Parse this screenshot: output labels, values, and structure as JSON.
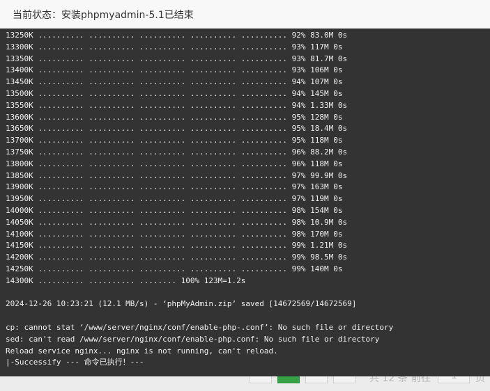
{
  "dialog": {
    "title": "当前状态：安装phpmyadmin-5.1已结束"
  },
  "terminal": {
    "lines": [
      "13250K .......... .......... .......... .......... .......... 92% 83.0M 0s",
      "13300K .......... .......... .......... .......... .......... 93% 117M 0s",
      "13350K .......... .......... .......... .......... .......... 93% 81.7M 0s",
      "13400K .......... .......... .......... .......... .......... 93% 106M 0s",
      "13450K .......... .......... .......... .......... .......... 94% 107M 0s",
      "13500K .......... .......... .......... .......... .......... 94% 145M 0s",
      "13550K .......... .......... .......... .......... .......... 94% 1.33M 0s",
      "13600K .......... .......... .......... .......... .......... 95% 128M 0s",
      "13650K .......... .......... .......... .......... .......... 95% 18.4M 0s",
      "13700K .......... .......... .......... .......... .......... 95% 118M 0s",
      "13750K .......... .......... .......... .......... .......... 96% 88.2M 0s",
      "13800K .......... .......... .......... .......... .......... 96% 118M 0s",
      "13850K .......... .......... .......... .......... .......... 97% 99.9M 0s",
      "13900K .......... .......... .......... .......... .......... 97% 163M 0s",
      "13950K .......... .......... .......... .......... .......... 97% 119M 0s",
      "14000K .......... .......... .......... .......... .......... 98% 154M 0s",
      "14050K .......... .......... .......... .......... .......... 98% 10.9M 0s",
      "14100K .......... .......... .......... .......... .......... 98% 170M 0s",
      "14150K .......... .......... .......... .......... .......... 99% 1.21M 0s",
      "14200K .......... .......... .......... .......... .......... 99% 98.5M 0s",
      "14250K .......... .......... .......... .......... .......... 99% 140M 0s",
      "14300K .......... .......... ........ 100% 123M=1.2s",
      "",
      "2024-12-26 10:23:21 (12.1 MB/s) - ‘phpMyAdmin.zip’ saved [14672569/14672569]",
      "",
      "cp: cannot stat ‘/www/server/nginx/conf/enable-php-.conf’: No such file or directory",
      "sed: can't read /www/server/nginx/conf/enable-php.conf: No such file or directory",
      "Reload service nginx... nginx is not running, can't reload.",
      "|-Successify --- 命令已执行！---"
    ]
  },
  "background": {
    "pager_summary": "共 12 条",
    "goto_label": "前往",
    "goto_page": "1",
    "page_unit": "页"
  }
}
